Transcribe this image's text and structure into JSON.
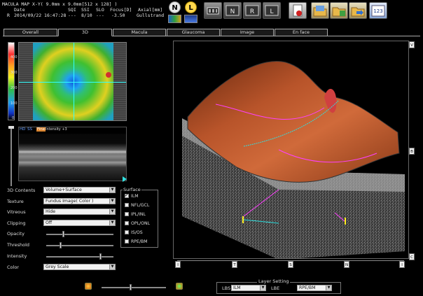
{
  "header": {
    "line1": "MACULA MAP X-Y( 9.0mm x 9.0mm[512 x 128] )",
    "col_date_label": "Date",
    "col_sqi_label": "SQI",
    "col_ssi_label": "SSI",
    "col_slo_label": "SLO",
    "col_focus_label": "Focus[D]",
    "col_axial_label": "Axial[mm]",
    "eye": "R",
    "date": "2014/09/22 16:47:28",
    "sqi": "---",
    "ssi": "8/10",
    "slo": "---",
    "focus": "-3.50",
    "axial": "Gullstrand",
    "eye_n": "N",
    "eye_l": "L",
    "tool_count_label": "123"
  },
  "tabs": [
    {
      "label": "Overall"
    },
    {
      "label": "3D"
    },
    {
      "label": "Macula"
    },
    {
      "label": "Glaucoma"
    },
    {
      "label": "Image"
    },
    {
      "label": "En face"
    }
  ],
  "colorbar": {
    "ticks": [
      "500",
      "400",
      "300",
      "200",
      "100",
      "0"
    ]
  },
  "bscan": {
    "hd_label": "HD",
    "ss_label": "SS",
    "fine_label": "Fine",
    "intensity_label": "Intensity +3"
  },
  "controls": {
    "contents_label": "3D Contents",
    "contents_value": "Volume+Surface",
    "texture_label": "Texture",
    "texture_value": "Fundus Image( Color )",
    "vitreous_label": "Vitreous",
    "vitreous_value": "Hide",
    "clipping_label": "Clipping",
    "clipping_value": "Off",
    "opacity_label": "Opacity",
    "opacity_level": 0.25,
    "threshold_label": "Threshold",
    "threshold_level": 0.2,
    "intensity_label": "Intensity",
    "intensity_level": 0.82,
    "color_label": "Color",
    "color_value": "Grey Scale"
  },
  "surface": {
    "title": "Surface",
    "items": [
      {
        "label": "ILM",
        "checked": true
      },
      {
        "label": "NFL/GCL",
        "checked": false
      },
      {
        "label": "IPL/INL",
        "checked": false
      },
      {
        "label": "OPL/ONL",
        "checked": false
      },
      {
        "label": "IS/OS",
        "checked": false
      },
      {
        "label": "RPE/BM",
        "checked": false
      }
    ]
  },
  "view3d": {
    "side_top": "V",
    "side_mid": "B",
    "side_bot": "C",
    "axis_markers": [
      "I",
      "T",
      "S",
      "N",
      "I"
    ]
  },
  "layer_setting": {
    "title": "Layer Setting",
    "lbs_label": "LBS",
    "lbs_value": "ILM",
    "lbe_label": "LBE",
    "lbe_value": "RPE/BM"
  },
  "zoom_level": 0.45,
  "colors": {
    "accent_orange": "#d9822b",
    "ilm_line": "#ff40ff",
    "scan_line": "#40e0d0"
  }
}
